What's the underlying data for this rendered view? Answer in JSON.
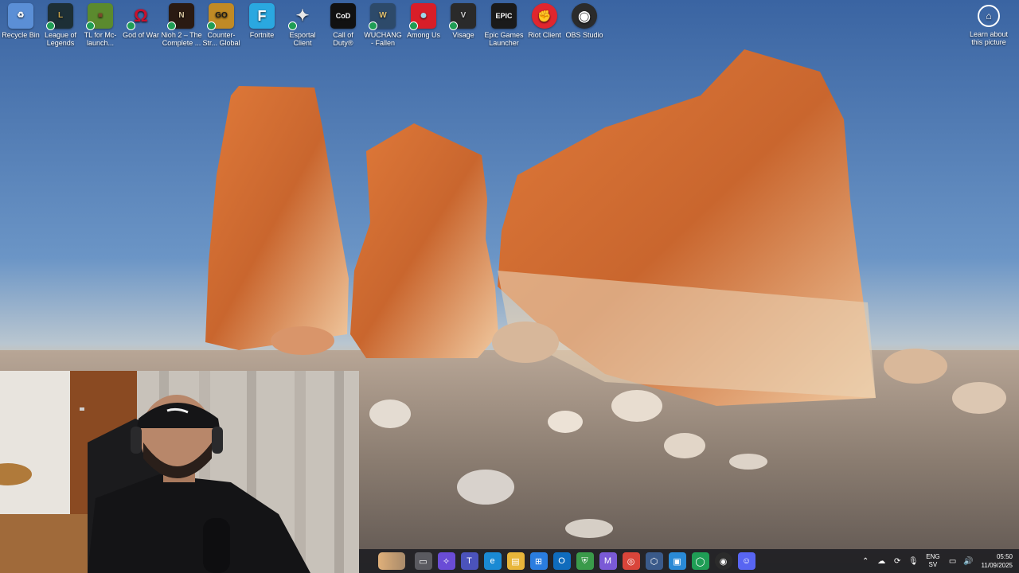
{
  "desktop": {
    "icons": [
      {
        "label": "Recycle Bin",
        "icon": "recycle-bin-icon",
        "color": "#5b8fd6",
        "glyph": "♻"
      },
      {
        "label": "League of Legends",
        "icon": "league-of-legends-icon",
        "color": "#1d2f36",
        "glyph": "L"
      },
      {
        "label": "TL for Mc-launch...",
        "icon": "tlauncher-icon",
        "color": "#5b8a2e",
        "glyph": "■"
      },
      {
        "label": "God of War",
        "icon": "god-of-war-icon",
        "color": "#ffffff",
        "glyph": "Ω"
      },
      {
        "label": "Nioh 2 – The Complete ...",
        "icon": "nioh2-icon",
        "color": "#2a1a12",
        "glyph": "N"
      },
      {
        "label": "Counter-Str... Global Offe...",
        "icon": "counter-strike-icon",
        "color": "#c08a25",
        "glyph": "GO"
      },
      {
        "label": "Fortnite",
        "icon": "fortnite-icon",
        "color": "#2aa8e0",
        "glyph": "F"
      },
      {
        "label": "Esportal Client",
        "icon": "esportal-client-icon",
        "color": "#3a4a5a",
        "glyph": "✦"
      },
      {
        "label": "Call of Duty®",
        "icon": "call-of-duty-icon",
        "color": "#111111",
        "glyph": "CoD"
      },
      {
        "label": "WUCHANG - Fallen Feat...",
        "icon": "wuchang-icon",
        "color": "#2d4a6a",
        "glyph": "W"
      },
      {
        "label": "Among Us",
        "icon": "among-us-icon",
        "color": "#d81e28",
        "glyph": "●"
      },
      {
        "label": "Visage",
        "icon": "visage-icon",
        "color": "#2a2a2a",
        "glyph": "V"
      },
      {
        "label": "Epic Games Launcher",
        "icon": "epic-games-icon",
        "color": "#1a1a1a",
        "glyph": "EPIC"
      },
      {
        "label": "Riot Client",
        "icon": "riot-client-icon",
        "color": "#e0262e",
        "glyph": "✊"
      },
      {
        "label": "OBS Studio",
        "icon": "obs-studio-icon",
        "color": "#2b2b2b",
        "glyph": "◉"
      }
    ],
    "learn": {
      "label": "Learn about this picture",
      "icon": "learn-about-picture-icon"
    }
  },
  "taskbar": {
    "apps": [
      {
        "name": "file-manager-icon",
        "color": "#5a5a60",
        "glyph": "▭"
      },
      {
        "name": "copilot-icon",
        "color": "#6a4cd6",
        "glyph": "✧"
      },
      {
        "name": "teams-icon",
        "color": "#4b53bc",
        "glyph": "T"
      },
      {
        "name": "edge-icon",
        "color": "#1a8ad4",
        "glyph": "e"
      },
      {
        "name": "file-explorer-icon",
        "color": "#e8b63a",
        "glyph": "▤"
      },
      {
        "name": "store-icon",
        "color": "#2a7de0",
        "glyph": "⊞"
      },
      {
        "name": "outlook-icon",
        "color": "#0f6cbd",
        "glyph": "O"
      },
      {
        "name": "vpn-shield-icon",
        "color": "#3a9a4a",
        "glyph": "⛨"
      },
      {
        "name": "m365-icon",
        "color": "#7a5ad6",
        "glyph": "M"
      },
      {
        "name": "chrome-icon",
        "color": "#d9453a",
        "glyph": "◎"
      },
      {
        "name": "app-box-icon",
        "color": "#3a5a8a",
        "glyph": "⬡"
      },
      {
        "name": "photos-icon",
        "color": "#2a8ad6",
        "glyph": "▣"
      },
      {
        "name": "xbox-icon",
        "color": "#1f9d55",
        "glyph": "◯"
      },
      {
        "name": "obs-taskbar-icon",
        "color": "#2b2b2b",
        "glyph": "◉"
      },
      {
        "name": "discord-icon",
        "color": "#5865f2",
        "glyph": "☺"
      }
    ],
    "tray": {
      "lang_top": "ENG",
      "lang_bottom": "SV",
      "time": "05:50",
      "date": "11/09/2025"
    }
  }
}
